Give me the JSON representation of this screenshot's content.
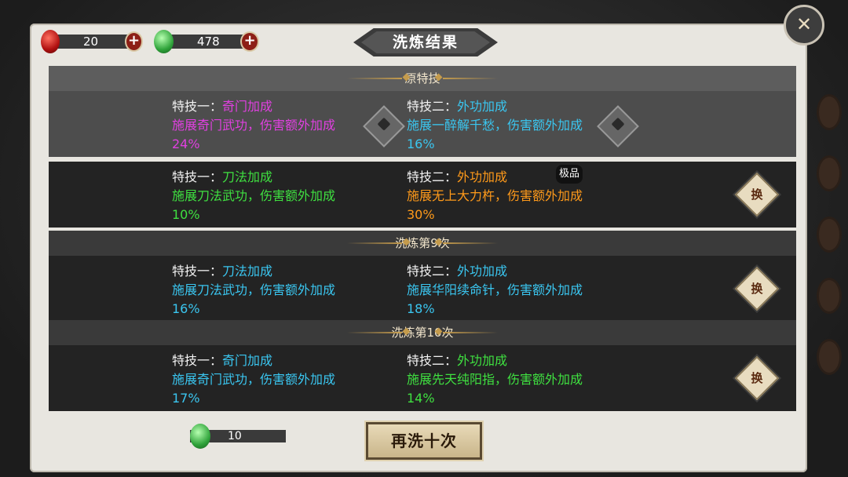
{
  "currency": {
    "red_count": "20",
    "jade_count": "478"
  },
  "title": "洗炼结果",
  "sections": {
    "original_header": "原特技",
    "wash9_header": "洗炼第9次",
    "wash10_header": "洗炼第10次"
  },
  "rows": [
    {
      "s1_label": "特技一：",
      "s1_name": "奇门加成",
      "s1_desc": "施展奇门武功，伤害额外加成24%",
      "s2_label": "特技二：",
      "s2_name": "外功加成",
      "s2_desc": "施展一醉解千愁，伤害额外加成16%",
      "colors": {
        "s1": "#e040e0",
        "s2": "#3ac6f0"
      }
    },
    {
      "s1_label": "特技一：",
      "s1_name": "刀法加成",
      "s1_desc": "施展刀法武功，伤害额外加成10%",
      "s2_label": "特技二：",
      "s2_name": "外功加成",
      "s2_desc": "施展无上大力杵，伤害额外加成30%",
      "tag": "极品",
      "swap_label": "换",
      "colors": {
        "s1": "#3fe040",
        "s2": "#ff9a1a"
      }
    },
    {
      "s1_label": "特技一：",
      "s1_name": "刀法加成",
      "s1_desc": "施展刀法武功，伤害额外加成16%",
      "s2_label": "特技二：",
      "s2_name": "外功加成",
      "s2_desc": "施展华阳续命针，伤害额外加成18%",
      "swap_label": "换",
      "colors": {
        "s1": "#3ac6f0",
        "s2": "#3ac6f0"
      }
    },
    {
      "s1_label": "特技一：",
      "s1_name": "奇门加成",
      "s1_desc": "施展奇门武功，伤害额外加成17%",
      "s2_label": "特技二：",
      "s2_name": "外功加成",
      "s2_desc": "施展先天纯阳指，伤害额外加成14%",
      "swap_label": "换",
      "colors": {
        "s1": "#3ac6f0",
        "s2": "#3fe040"
      }
    }
  ],
  "cost": {
    "value": "10"
  },
  "rewash_button": "再洗十次",
  "icons": {
    "close": "close-icon",
    "red_gem": "red-gem-icon",
    "jade": "jade-icon",
    "swap": "swap-icon",
    "lock": "lock-badge-icon"
  }
}
